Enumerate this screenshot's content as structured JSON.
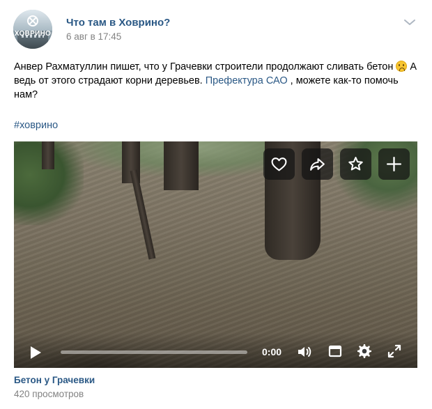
{
  "header": {
    "group_name": "Что там в Ховрино?",
    "date": "6 авг в 17:45",
    "avatar_label": "ХОВРИНО"
  },
  "post": {
    "text_part1": "Анвер Рахматуллин пишет, что у Грачевки строители продолжают сливать бетон ",
    "emoji": "sad-face-emoji",
    "text_part2": " А ведь от этого страдают корни деревьев. ",
    "mention": "Префектура САО",
    "text_part3": " , можете как-то помочь нам?",
    "hashtag": "#ховрино"
  },
  "video": {
    "overlay_buttons": [
      "heart-icon",
      "share-icon",
      "star-icon",
      "plus-icon"
    ],
    "time": "0:00",
    "progress": 0,
    "title": "Бетон у Грачевки",
    "views": "420 просмотров"
  },
  "colors": {
    "link": "#2a5885",
    "meta": "#828282",
    "overlay_button_bg": "#141414"
  }
}
